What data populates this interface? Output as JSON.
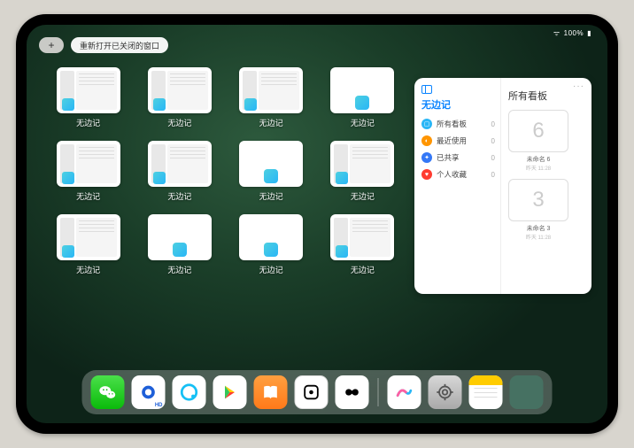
{
  "status": {
    "battery": "100%"
  },
  "controls": {
    "plus": "+",
    "reopen": "重新打开已关闭的窗口"
  },
  "grid": {
    "tiles": [
      {
        "label": "无边记",
        "variant": "cal"
      },
      {
        "label": "无边记",
        "variant": "cal"
      },
      {
        "label": "无边记",
        "variant": "cal"
      },
      {
        "label": "无边记",
        "variant": "plain"
      },
      {
        "label": "无边记",
        "variant": "cal"
      },
      {
        "label": "无边记",
        "variant": "cal"
      },
      {
        "label": "无边记",
        "variant": "plain"
      },
      {
        "label": "无边记",
        "variant": "cal"
      },
      {
        "label": "无边记",
        "variant": "cal"
      },
      {
        "label": "无边记",
        "variant": "plain"
      },
      {
        "label": "无边记",
        "variant": "plain"
      },
      {
        "label": "无边记",
        "variant": "cal"
      }
    ]
  },
  "panel": {
    "left_title": "无边记",
    "items": [
      {
        "label": "所有看板",
        "count": "0",
        "color": "#29b6f6",
        "glyph": "▢"
      },
      {
        "label": "最近使用",
        "count": "0",
        "color": "#ff9500",
        "glyph": "◐"
      },
      {
        "label": "已共享",
        "count": "0",
        "color": "#3478f6",
        "glyph": "✦"
      },
      {
        "label": "个人收藏",
        "count": "0",
        "color": "#ff3b30",
        "glyph": "♥"
      }
    ],
    "right_title": "所有看板",
    "more": "···",
    "cards": [
      {
        "glyph": "6",
        "title": "未命名 6",
        "sub": "昨天 11:28"
      },
      {
        "glyph": "3",
        "title": "未命名 3",
        "sub": "昨天 11:28"
      }
    ]
  },
  "dock": {
    "apps": [
      {
        "name": "wechat",
        "label": "WeChat"
      },
      {
        "name": "qqhd",
        "label": "QQ HD"
      },
      {
        "name": "qq",
        "label": "QQ"
      },
      {
        "name": "play",
        "label": "App"
      },
      {
        "name": "books",
        "label": "Books"
      },
      {
        "name": "dice",
        "label": "App"
      },
      {
        "name": "controller",
        "label": "App"
      },
      {
        "name": "freeform",
        "label": "Freeform"
      },
      {
        "name": "settings",
        "label": "Settings"
      },
      {
        "name": "notes",
        "label": "Notes"
      }
    ],
    "recent_folder": {
      "label": "Recent"
    }
  }
}
